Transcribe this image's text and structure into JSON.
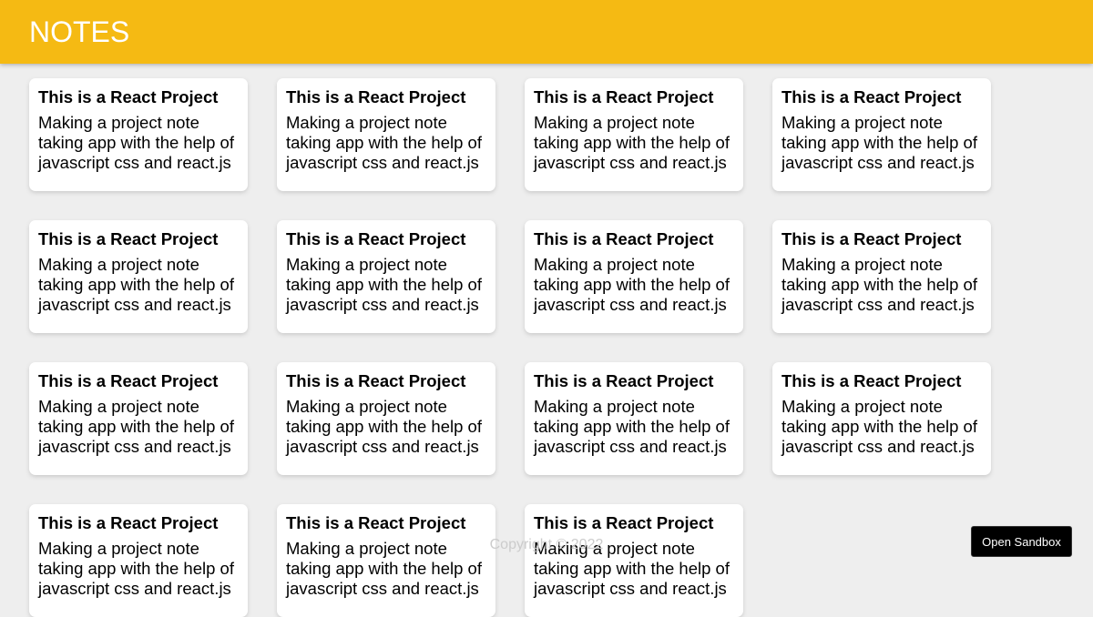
{
  "header": {
    "title": "NOTES"
  },
  "notes": [
    {
      "title": "This is a React Project",
      "content": "Making a project note taking app with the help of javascript css and react.js"
    },
    {
      "title": "This is a React Project",
      "content": "Making a project note taking app with the help of javascript css and react.js"
    },
    {
      "title": "This is a React Project",
      "content": "Making a project note taking app with the help of javascript css and react.js"
    },
    {
      "title": "This is a React Project",
      "content": "Making a project note taking app with the help of javascript css and react.js"
    },
    {
      "title": "This is a React Project",
      "content": "Making a project note taking app with the help of javascript css and react.js"
    },
    {
      "title": "This is a React Project",
      "content": "Making a project note taking app with the help of javascript css and react.js"
    },
    {
      "title": "This is a React Project",
      "content": "Making a project note taking app with the help of javascript css and react.js"
    },
    {
      "title": "This is a React Project",
      "content": "Making a project note taking app with the help of javascript css and react.js"
    },
    {
      "title": "This is a React Project",
      "content": "Making a project note taking app with the help of javascript css and react.js"
    },
    {
      "title": "This is a React Project",
      "content": "Making a project note taking app with the help of javascript css and react.js"
    },
    {
      "title": "This is a React Project",
      "content": "Making a project note taking app with the help of javascript css and react.js"
    },
    {
      "title": "This is a React Project",
      "content": "Making a project note taking app with the help of javascript css and react.js"
    },
    {
      "title": "This is a React Project",
      "content": "Making a project note taking app with the help of javascript css and react.js"
    },
    {
      "title": "This is a React Project",
      "content": "Making a project note taking app with the help of javascript css and react.js"
    },
    {
      "title": "This is a React Project",
      "content": "Making a project note taking app with the help of javascript css and react.js"
    }
  ],
  "footer": {
    "text": "Copyright © 2022"
  },
  "sandbox": {
    "label": "Open Sandbox"
  },
  "colors": {
    "header_bg": "#f5ba13",
    "page_bg": "#eeeeee",
    "note_bg": "#ffffff"
  }
}
